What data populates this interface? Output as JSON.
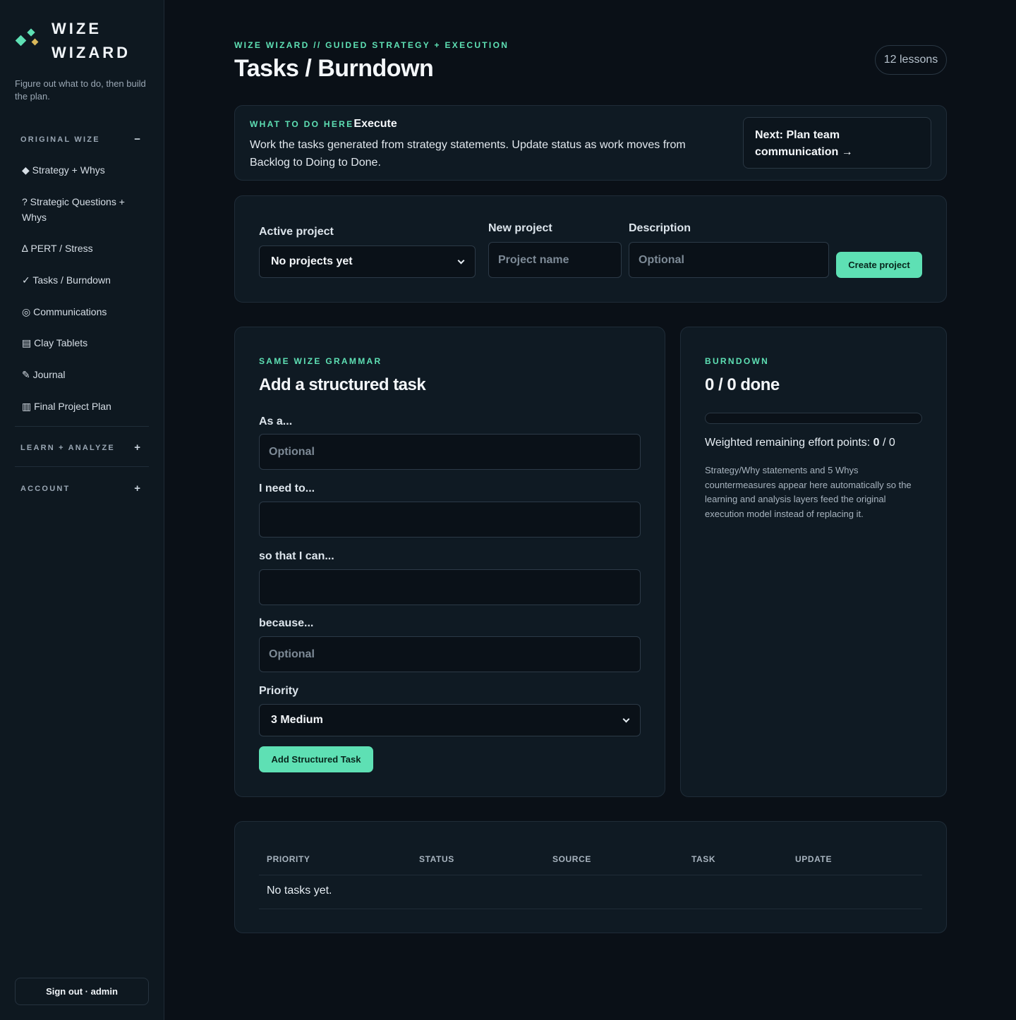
{
  "brand": {
    "line1": "WIZE",
    "line2": "WIZARD",
    "tagline": "Figure out what to do, then build the plan."
  },
  "sidebar": {
    "sections": [
      {
        "title": "ORIGINAL WIZE",
        "toggle": "−"
      },
      {
        "title": "LEARN + ANALYZE",
        "toggle": "+"
      },
      {
        "title": "ACCOUNT",
        "toggle": "+"
      }
    ],
    "items": [
      {
        "label": "◆ Strategy + Whys"
      },
      {
        "label": "? Strategic Questions + Whys"
      },
      {
        "label": "∆ PERT / Stress"
      },
      {
        "label": "✓ Tasks / Burndown"
      },
      {
        "label": "◎ Communications"
      },
      {
        "label": "▤ Clay Tablets"
      },
      {
        "label": "✎ Journal"
      },
      {
        "label": "▥ Final Project Plan"
      }
    ],
    "signout": "Sign out · admin"
  },
  "header": {
    "eyebrow": "WIZE WIZARD // GUIDED STRATEGY + EXECUTION",
    "title": "Tasks / Burndown",
    "lessons": "12 lessons"
  },
  "guide": {
    "eyebrow": "WHAT TO DO HERE",
    "title": "Execute",
    "text": "Work the tasks generated from strategy statements. Update status as work moves from Backlog to Doing to Done.",
    "next": "Next: Plan team communication →"
  },
  "project": {
    "active_label": "Active project",
    "active_value": "No projects yet",
    "new_label": "New project",
    "new_placeholder": "Project name",
    "desc_label": "Description",
    "desc_placeholder": "Optional",
    "create": "Create project"
  },
  "task_form": {
    "eyebrow": "SAME WIZE GRAMMAR",
    "title": "Add a structured task",
    "as_label": "As a...",
    "as_placeholder": "Optional",
    "need_label": "I need to...",
    "so_label": "so that I can...",
    "because_label": "because...",
    "because_placeholder": "Optional",
    "priority_label": "Priority",
    "priority_value": "3 Medium",
    "submit": "Add Structured Task"
  },
  "burndown": {
    "eyebrow": "BURNDOWN",
    "title": "0 / 0 done",
    "progress": 0,
    "effort_label": "Weighted remaining effort points:",
    "effort_done": "0",
    "effort_total": "/ 0",
    "note": "Strategy/Why statements and 5 Whys countermeasures appear here automatically so the learning and analysis layers feed the original execution model instead of replacing it."
  },
  "table": {
    "columns": [
      "PRIORITY",
      "STATUS",
      "SOURCE",
      "TASK",
      "UPDATE"
    ],
    "empty": "No tasks yet."
  },
  "colors": {
    "accent": "#5ee0b4",
    "background": "#0a1017",
    "card": "#0f1a23",
    "gold": "#d9b85a"
  }
}
